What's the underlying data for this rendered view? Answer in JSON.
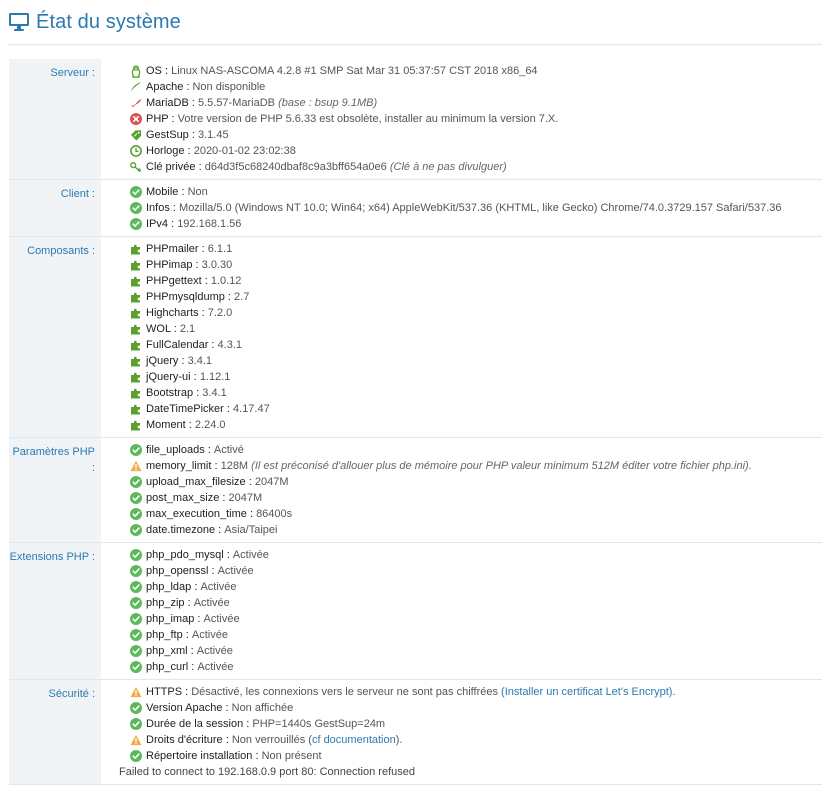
{
  "header": {
    "title": "État du système"
  },
  "colors": {
    "accent": "#2a7ab0",
    "ok": "#5cb85c",
    "warn": "#f0ad4e",
    "error": "#d9534f",
    "plugin": "#5aa02c"
  },
  "sections": [
    {
      "label": "Serveur :",
      "rows": [
        {
          "icon": "linux-tux-icon",
          "key": "OS :",
          "value": "Linux NAS-ASCOMA 4.2.8 #1 SMP Sat Mar 31 05:37:57 CST 2018 x86_64"
        },
        {
          "icon": "apache-feather-icon",
          "key": "Apache :",
          "value": "Non disponible"
        },
        {
          "icon": "mariadb-seal-icon",
          "key": "MariaDB :",
          "value": "5.5.57-MariaDB",
          "note": "(base : bsup 9.1MB)"
        },
        {
          "icon": "error-circle-icon",
          "key": "PHP :",
          "value": "Votre version de PHP 5.6.33 est obsolète, installer au minimum la version 7.X."
        },
        {
          "icon": "ticket-tag-icon",
          "key": "GestSup :",
          "value": "3.1.45"
        },
        {
          "icon": "clock-icon",
          "key": "Horloge :",
          "value": "2020-01-02 23:02:38"
        },
        {
          "icon": "key-icon",
          "key": "Clé privée :",
          "value": "d64d3f5c68240dbaf8c9a3bff654a0e6",
          "note": "(Clé à ne pas divulguer)"
        }
      ]
    },
    {
      "label": "Client :",
      "rows": [
        {
          "icon": "check-circle-icon",
          "key": "Mobile :",
          "value": "Non"
        },
        {
          "icon": "check-circle-icon",
          "key": "Infos :",
          "value": "Mozilla/5.0 (Windows NT 10.0; Win64; x64) AppleWebKit/537.36 (KHTML, like Gecko) Chrome/74.0.3729.157 Safari/537.36"
        },
        {
          "icon": "check-circle-icon",
          "key": "IPv4 :",
          "value": "192.168.1.56"
        }
      ]
    },
    {
      "label": "Composants :",
      "rows": [
        {
          "icon": "puzzle-icon",
          "key": "PHPmailer :",
          "value": "6.1.1"
        },
        {
          "icon": "puzzle-icon",
          "key": "PHPimap :",
          "value": "3.0.30"
        },
        {
          "icon": "puzzle-icon",
          "key": "PHPgettext :",
          "value": "1.0.12"
        },
        {
          "icon": "puzzle-icon",
          "key": "PHPmysqldump :",
          "value": "2.7"
        },
        {
          "icon": "puzzle-icon",
          "key": "Highcharts :",
          "value": "7.2.0"
        },
        {
          "icon": "puzzle-icon",
          "key": "WOL :",
          "value": "2.1"
        },
        {
          "icon": "puzzle-icon",
          "key": "FullCalendar :",
          "value": "4.3.1"
        },
        {
          "icon": "puzzle-icon",
          "key": "jQuery :",
          "value": "3.4.1"
        },
        {
          "icon": "puzzle-icon",
          "key": "jQuery-ui :",
          "value": "1.12.1"
        },
        {
          "icon": "puzzle-icon",
          "key": "Bootstrap :",
          "value": "3.4.1"
        },
        {
          "icon": "puzzle-icon",
          "key": "DateTimePicker :",
          "value": "4.17.47"
        },
        {
          "icon": "puzzle-icon",
          "key": "Moment :",
          "value": "2.24.0"
        }
      ]
    },
    {
      "label": "Paramètres PHP :",
      "rows": [
        {
          "icon": "check-circle-icon",
          "key": "file_uploads :",
          "value": "Activé"
        },
        {
          "icon": "warning-triangle-icon",
          "key": "memory_limit :",
          "value": "128M",
          "note": "(Il est préconisé d'allouer plus de mémoire pour PHP valeur minimum 512M éditer votre fichier php.ini)."
        },
        {
          "icon": "check-circle-icon",
          "key": "upload_max_filesize :",
          "value": "2047M"
        },
        {
          "icon": "check-circle-icon",
          "key": "post_max_size :",
          "value": "2047M"
        },
        {
          "icon": "check-circle-icon",
          "key": "max_execution_time :",
          "value": "86400s"
        },
        {
          "icon": "check-circle-icon",
          "key": "date.timezone :",
          "value": "Asia/Taipei"
        }
      ]
    },
    {
      "label": "Extensions PHP :",
      "rows": [
        {
          "icon": "check-circle-icon",
          "key": "php_pdo_mysql :",
          "value": "Activée"
        },
        {
          "icon": "check-circle-icon",
          "key": "php_openssl :",
          "value": "Activée"
        },
        {
          "icon": "check-circle-icon",
          "key": "php_ldap :",
          "value": "Activée"
        },
        {
          "icon": "check-circle-icon",
          "key": "php_zip :",
          "value": "Activée"
        },
        {
          "icon": "check-circle-icon",
          "key": "php_imap :",
          "value": "Activée"
        },
        {
          "icon": "check-circle-icon",
          "key": "php_ftp :",
          "value": "Activée"
        },
        {
          "icon": "check-circle-icon",
          "key": "php_xml :",
          "value": "Activée"
        },
        {
          "icon": "check-circle-icon",
          "key": "php_curl :",
          "value": "Activée"
        }
      ]
    },
    {
      "label": "Sécurité :",
      "rows": [
        {
          "icon": "warning-triangle-icon",
          "key": "HTTPS :",
          "value": "Désactivé, les connexions vers le serveur ne sont pas chiffrées",
          "link": "(Installer un certificat Let's Encrypt)",
          "after": "."
        },
        {
          "icon": "check-circle-icon",
          "key": "Version Apache :",
          "value": "Non affichée"
        },
        {
          "icon": "check-circle-icon",
          "key": "Durée de la session :",
          "value": "PHP=1440s GestSup=24m"
        },
        {
          "icon": "warning-triangle-icon",
          "key": "Droits d'écriture :",
          "value": "Non verrouillés (",
          "link": "cf documentation",
          "after": ")."
        },
        {
          "icon": "check-circle-icon",
          "key": "Répertoire installation :",
          "value": "Non présent"
        }
      ],
      "footer": "Failed to connect to 192.168.0.9 port 80: Connection refused"
    }
  ]
}
